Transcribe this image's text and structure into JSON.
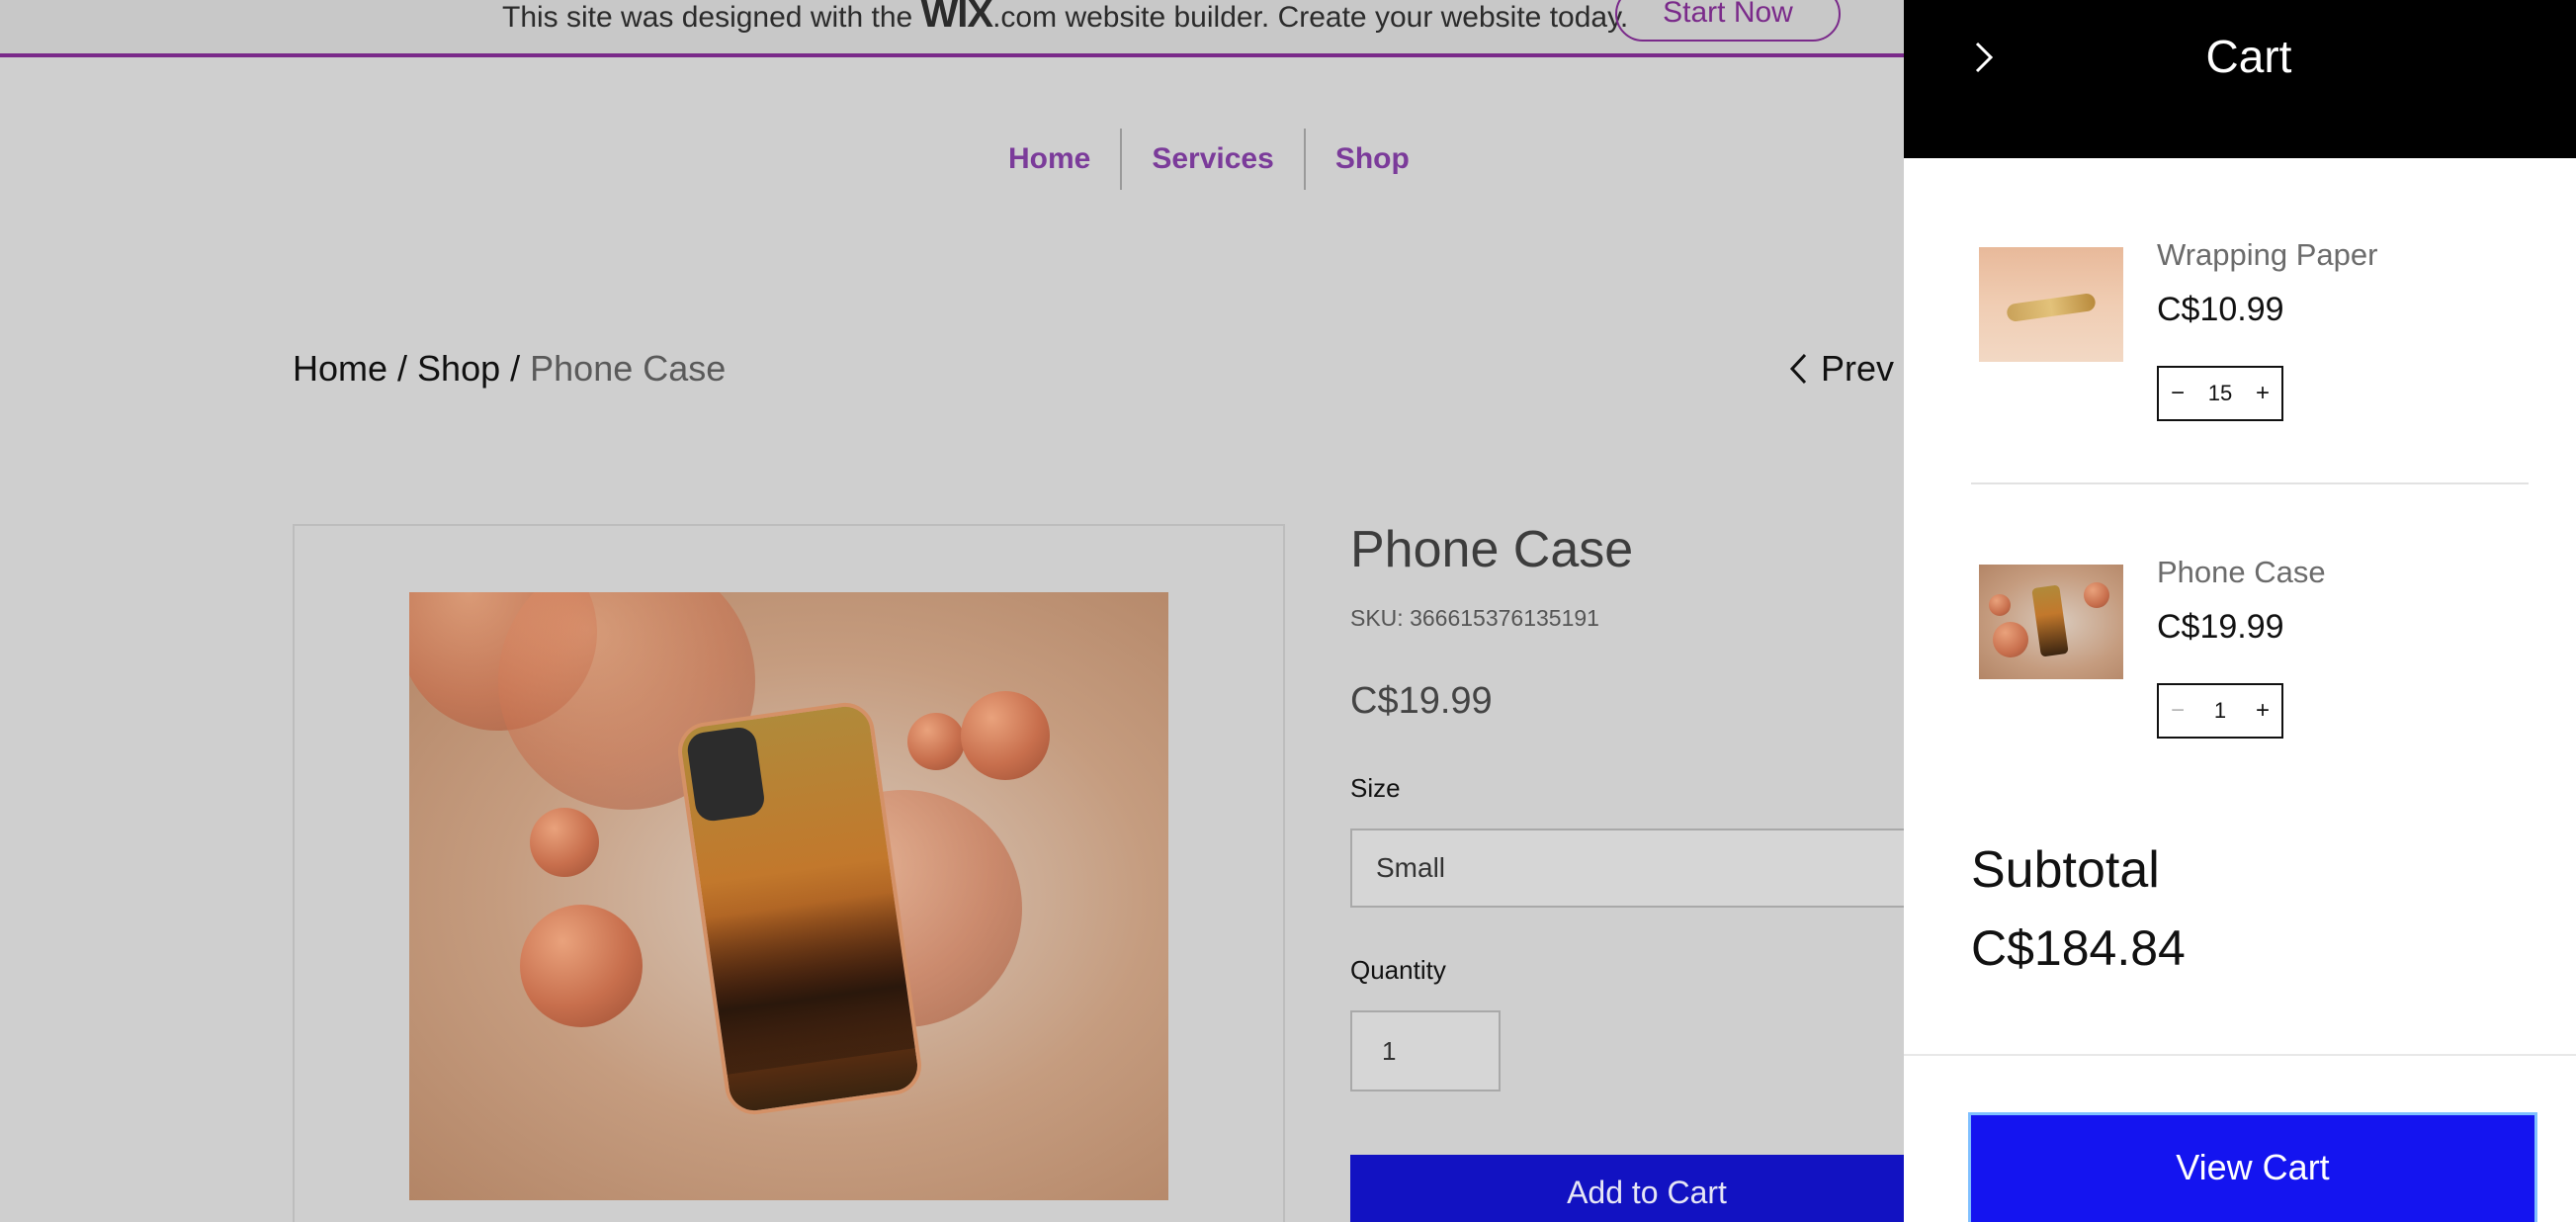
{
  "banner": {
    "text_before": "This site was designed with the ",
    "wix_logo": "WIX",
    "text_after": ".com website builder. Create your website today.",
    "cta": "Start Now"
  },
  "nav": {
    "items": [
      {
        "label": "Home"
      },
      {
        "label": "Services"
      },
      {
        "label": "Shop"
      }
    ]
  },
  "breadcrumb": {
    "home": "Home",
    "sep1": " / ",
    "shop": "Shop",
    "sep2": " / ",
    "current": "Phone Case"
  },
  "pager": {
    "prev": "Prev"
  },
  "product": {
    "title": "Phone Case",
    "sku": "SKU: 366615376135191",
    "price": "C$19.99",
    "size_label": "Size",
    "size_value": "Small",
    "quantity_label": "Quantity",
    "quantity_value": "1",
    "add_to_cart": "Add to Cart"
  },
  "cart": {
    "title": "Cart",
    "items": [
      {
        "name": "Wrapping Paper",
        "price": "C$10.99",
        "quantity": "15"
      },
      {
        "name": "Phone Case",
        "price": "C$19.99",
        "quantity": "1"
      }
    ],
    "subtotal_label": "Subtotal",
    "subtotal_value": "C$184.84",
    "view_cart": "View Cart"
  },
  "colors": {
    "banner_accent": "#7a2a8a",
    "nav_link": "#7b3b9a",
    "add_to_cart_bg": "#1212c2",
    "cart_header_bg": "#000000",
    "view_cart_bg": "#1414f0"
  }
}
